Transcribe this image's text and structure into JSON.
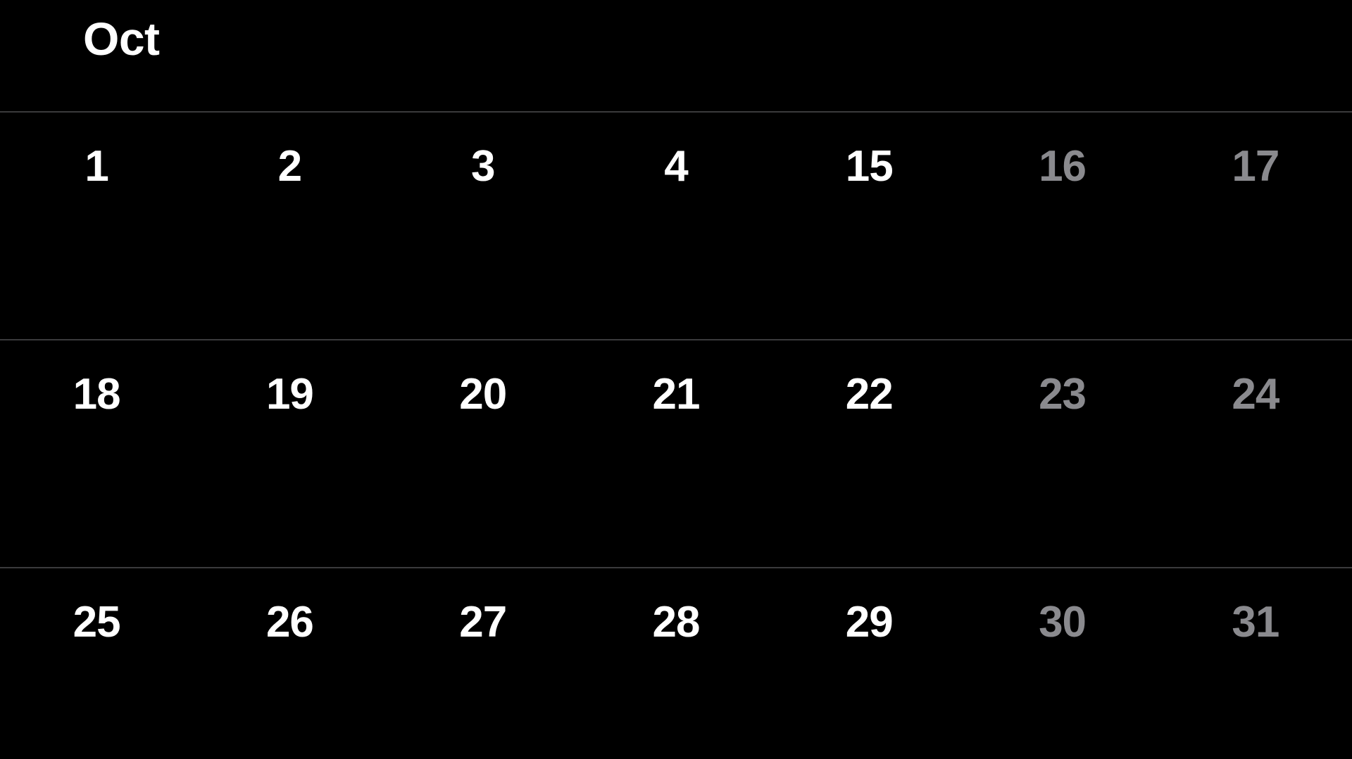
{
  "header": {
    "month_label": "Oct"
  },
  "colors": {
    "background": "#000000",
    "day_text": "#ffffff",
    "day_text_dimmed": "#8a8a8e",
    "divider": "#3a3a3c"
  },
  "calendar": {
    "columns": 7,
    "weeks": [
      {
        "days": [
          {
            "label": "1",
            "dimmed": false
          },
          {
            "label": "2",
            "dimmed": false
          },
          {
            "label": "3",
            "dimmed": false
          },
          {
            "label": "4",
            "dimmed": false
          },
          {
            "label": "15",
            "dimmed": false
          },
          {
            "label": "16",
            "dimmed": true
          },
          {
            "label": "17",
            "dimmed": true
          }
        ]
      },
      {
        "days": [
          {
            "label": "18",
            "dimmed": false
          },
          {
            "label": "19",
            "dimmed": false
          },
          {
            "label": "20",
            "dimmed": false
          },
          {
            "label": "21",
            "dimmed": false
          },
          {
            "label": "22",
            "dimmed": false
          },
          {
            "label": "23",
            "dimmed": true
          },
          {
            "label": "24",
            "dimmed": true
          }
        ]
      },
      {
        "days": [
          {
            "label": "25",
            "dimmed": false
          },
          {
            "label": "26",
            "dimmed": false
          },
          {
            "label": "27",
            "dimmed": false
          },
          {
            "label": "28",
            "dimmed": false
          },
          {
            "label": "29",
            "dimmed": false
          },
          {
            "label": "30",
            "dimmed": true
          },
          {
            "label": "31",
            "dimmed": true
          }
        ]
      }
    ]
  }
}
